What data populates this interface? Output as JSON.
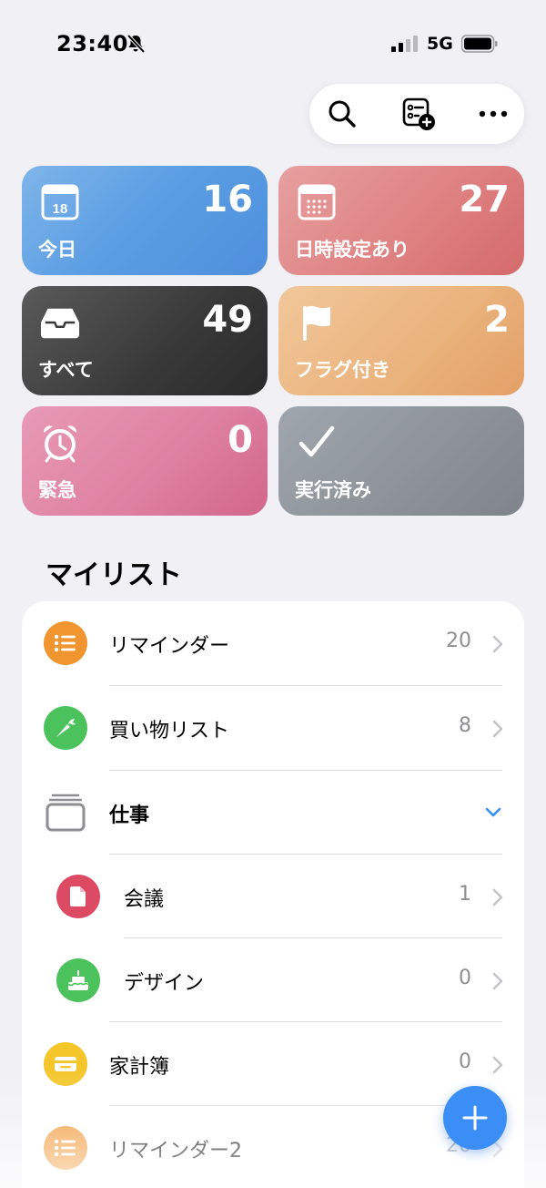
{
  "status": {
    "time": "23:40",
    "network": "5G"
  },
  "toolbar": {
    "search_icon": "search-icon",
    "add_list_icon": "add-list-icon",
    "more_icon": "more-icon"
  },
  "cards": {
    "today": {
      "label": "今日",
      "count": "16",
      "date": "18",
      "color": "#5a9de3"
    },
    "scheduled": {
      "label": "日時設定あり",
      "count": "27",
      "color": "#de7f80"
    },
    "all": {
      "label": "すべて",
      "count": "49",
      "color": "#383838"
    },
    "flagged": {
      "label": "フラグ付き",
      "count": "2",
      "color": "#eab27c"
    },
    "urgent": {
      "label": "緊急",
      "count": "0",
      "color": "#de7fa0"
    },
    "completed": {
      "label": "実行済み",
      "count": "",
      "color": "#8c9298"
    }
  },
  "section": {
    "title": "マイリスト"
  },
  "lists": [
    {
      "label": "リマインダー",
      "count": "20",
      "icon": "list-icon",
      "color": "#f0952f"
    },
    {
      "label": "買い物リスト",
      "count": "8",
      "icon": "carrot-icon",
      "color": "#4cc25d"
    },
    {
      "label": "仕事",
      "count": "",
      "icon": "folder-stack-icon",
      "color": "#8e8e93"
    },
    {
      "label": "会議",
      "count": "1",
      "icon": "document-icon",
      "color": "#dc4a63"
    },
    {
      "label": "デザイン",
      "count": "0",
      "icon": "cake-icon",
      "color": "#4cc25d"
    },
    {
      "label": "家計簿",
      "count": "0",
      "icon": "wallet-icon",
      "color": "#f4c62a"
    },
    {
      "label": "リマインダー2",
      "count": "20",
      "icon": "list-icon",
      "color": "#f0952f"
    }
  ],
  "accent": "#3a8ef5"
}
